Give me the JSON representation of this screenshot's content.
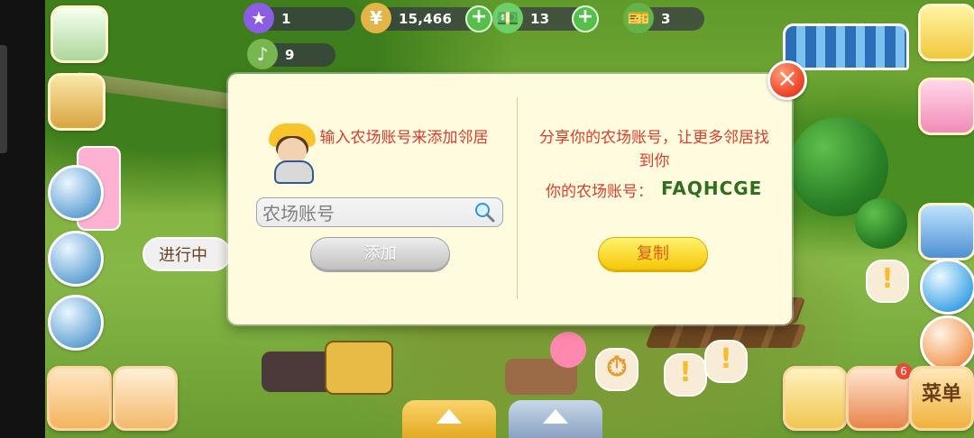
{
  "hud": {
    "level": "1",
    "coins": "15,466",
    "cash": "13",
    "orders": "3",
    "music_count": "9"
  },
  "scene": {
    "progress_text": "进行中",
    "notification_count": "6",
    "menu_label": "菜单"
  },
  "dialog": {
    "left_title": "输入农场账号来添加邻居",
    "input_placeholder": "农场账号",
    "add_button": "添加",
    "right_title": "分享你的农场账号，让更多邻居找到你",
    "account_label": "你的农场账号：",
    "account_code": "FAQHCGE",
    "copy_button": "复制"
  },
  "colors": {
    "modal_bg": "#fffbdf",
    "accent_red": "#d93d2c",
    "accent_green": "#2f6e1d",
    "yellow_button": "#f4c400"
  }
}
